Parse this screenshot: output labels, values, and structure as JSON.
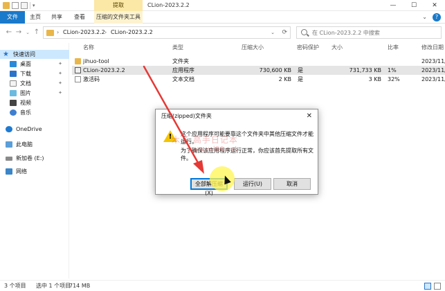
{
  "window": {
    "title": "CLion-2023.2.2",
    "contextual_tab_top": "提取",
    "controls": {
      "minimize": "—",
      "maximize": "☐",
      "close": "✕"
    }
  },
  "ribbon": {
    "tabs": [
      "文件",
      "主页",
      "共享",
      "查看",
      "压缩的文件夹工具"
    ],
    "expand": "⌄",
    "help": "?"
  },
  "address": {
    "back": "←",
    "forward": "→",
    "dropdown": "⌄",
    "up": "↑",
    "crumbs": [
      "CLion-2023.2.2",
      "CLion-2023.2.2"
    ],
    "separator": "›",
    "refresh": "⟳",
    "search_placeholder": "在 CLion-2023.2.2 中搜索"
  },
  "sidebar": {
    "items": [
      {
        "label": "快速访问",
        "icon": "star-icon"
      },
      {
        "label": "桌面",
        "icon": "desktop-icon",
        "pinned": true
      },
      {
        "label": "下载",
        "icon": "download-icon",
        "pinned": true
      },
      {
        "label": "文档",
        "icon": "documents-icon",
        "pinned": true
      },
      {
        "label": "图片",
        "icon": "pictures-icon",
        "pinned": true
      },
      {
        "label": "视频",
        "icon": "videos-icon"
      },
      {
        "label": "音乐",
        "icon": "music-icon"
      },
      {
        "label": "OneDrive",
        "icon": "cloud-icon"
      },
      {
        "label": "此电脑",
        "icon": "computer-icon"
      },
      {
        "label": "新加卷 (E:)",
        "icon": "drive-icon"
      },
      {
        "label": "网络",
        "icon": "network-icon"
      }
    ],
    "pin_glyph": "✦"
  },
  "filelist": {
    "columns": [
      "名称",
      "类型",
      "压缩大小",
      "密码保护",
      "大小",
      "比率",
      "修改日期"
    ],
    "rows": [
      {
        "name": "jihuo-tool",
        "type": "文件夹",
        "packed": "",
        "password": "",
        "size": "",
        "ratio": "",
        "date": "2023/11/",
        "icon": "folder-icon"
      },
      {
        "name": "CLion-2023.2.2",
        "type": "应用程序",
        "packed": "730,600 KB",
        "password": "是",
        "size": "731,733 KB",
        "ratio": "1%",
        "date": "2023/11/",
        "icon": "application-icon"
      },
      {
        "name": "激活码",
        "type": "文本文档",
        "packed": "2 KB",
        "password": "是",
        "size": "3 KB",
        "ratio": "32%",
        "date": "2023/11/",
        "icon": "text-file-icon"
      }
    ]
  },
  "status": {
    "count": "3 个项目",
    "selected": "选中 1 个项目",
    "size": "714 MB"
  },
  "dialog": {
    "title": "压缩(zipped)文件夹",
    "message_1": "这个应用程序可能要靠这个文件夹中其他压缩文件才能运行。",
    "message_2": "为了确保该应用程序运行正常，你应该首先提取所有文件。",
    "close": "✕",
    "buttons": {
      "extract_all": "全部解压缩(X)",
      "run": "运行(U)",
      "cancel": "取消"
    }
  },
  "watermark": {
    "line1": "木子 高手日记本",
    "line2": "www.ysl86.net"
  },
  "colors": {
    "accent": "#1979ca",
    "contextual_tab": "#fbe7a6",
    "selection": "#cce8ff",
    "annotation_arrow": "#e53935",
    "cursor_highlight": "#fff550"
  }
}
